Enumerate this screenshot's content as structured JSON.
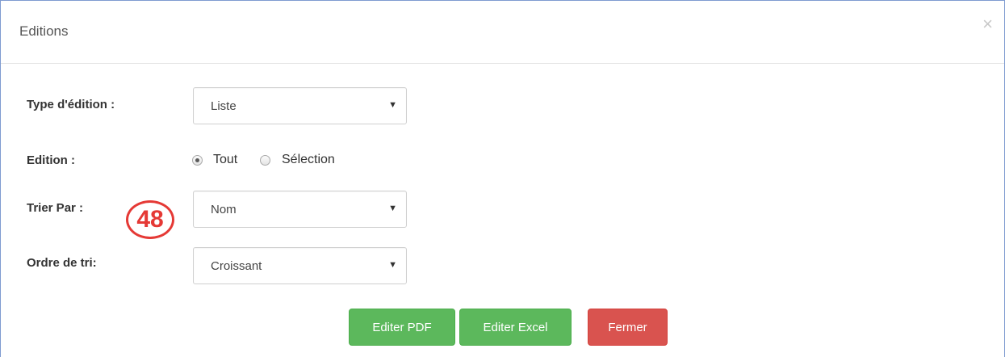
{
  "dialog": {
    "title": "Editions",
    "close_glyph": "×"
  },
  "form": {
    "type_edition": {
      "label": "Type d'édition :",
      "value": "Liste"
    },
    "edition": {
      "label": "Edition :",
      "options": [
        {
          "label": "Tout",
          "checked": true
        },
        {
          "label": "Sélection",
          "checked": false
        }
      ]
    },
    "trier_par": {
      "label": "Trier Par :",
      "value": "Nom",
      "annotation": "48"
    },
    "ordre_tri": {
      "label": "Ordre de tri:",
      "value": "Croissant"
    }
  },
  "actions": {
    "pdf_label": "Editer PDF",
    "excel_label": "Editer Excel",
    "close_label": "Fermer"
  },
  "colors": {
    "success": "#5cb85c",
    "danger": "#d9534f",
    "annotation": "#e53935"
  }
}
